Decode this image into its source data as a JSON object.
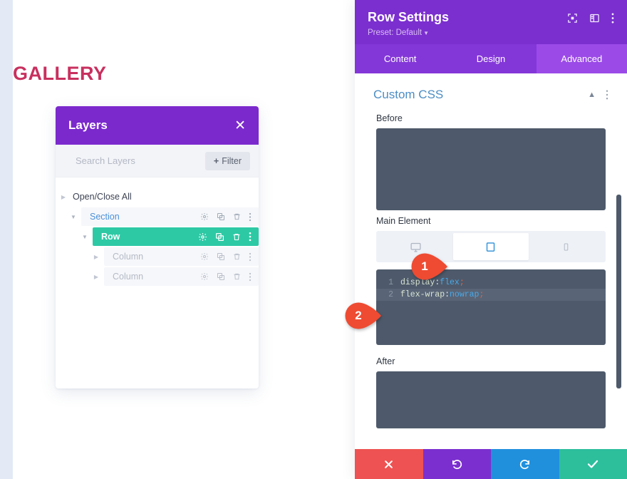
{
  "canvas": {
    "heading": "GALLERY",
    "heading_color": "#c8305f"
  },
  "layers_panel": {
    "title": "Layers",
    "close_icon": "close-icon",
    "search_placeholder": "Search Layers",
    "search_value": "",
    "filter_label": "Filter",
    "filter_plus": "+",
    "open_close_all": "Open/Close All",
    "row_icons": [
      "gear-icon",
      "duplicate-icon",
      "trash-icon",
      "more-vertical-icon"
    ],
    "tree": [
      {
        "label": "Section",
        "state": "plain",
        "indent": 1,
        "expanded": true
      },
      {
        "label": "Row",
        "state": "active",
        "indent": 2,
        "expanded": true
      },
      {
        "label": "Column",
        "state": "dim",
        "indent": 3,
        "expanded": false
      },
      {
        "label": "Column",
        "state": "dim",
        "indent": 3,
        "expanded": false
      }
    ]
  },
  "settings": {
    "title": "Row Settings",
    "preset_label": "Preset: Default",
    "header_icons": [
      "focus-icon",
      "layout-panel-icon",
      "more-vertical-icon"
    ],
    "tabs": [
      {
        "label": "Content",
        "active": false
      },
      {
        "label": "Design",
        "active": false
      },
      {
        "label": "Advanced",
        "active": true
      }
    ],
    "section": {
      "title": "Custom CSS",
      "collapse_icon": "chevron-up-icon",
      "menu_icon": "more-vertical-icon"
    },
    "fields": {
      "before_label": "Before",
      "main_element_label": "Main Element",
      "after_label": "After"
    },
    "device_toggle": {
      "options": [
        {
          "name": "desktop",
          "active": false
        },
        {
          "name": "tablet",
          "active": true
        },
        {
          "name": "phone",
          "active": false
        }
      ]
    },
    "code_editor": {
      "lines": [
        {
          "num": "1",
          "prop": "display",
          "colon": ":",
          "value": "flex",
          "semi": ";",
          "highlight": false
        },
        {
          "num": "2",
          "prop": "flex-wrap",
          "colon": ":",
          "value": "nowrap",
          "semi": ";",
          "highlight": true
        }
      ]
    },
    "bottom_bar": [
      {
        "name": "cancel-button",
        "icon": "close-icon",
        "color": "#ee5252"
      },
      {
        "name": "undo-button",
        "icon": "undo-icon",
        "color": "#7b2fcf"
      },
      {
        "name": "redo-button",
        "icon": "redo-icon",
        "color": "#2090dd"
      },
      {
        "name": "save-button",
        "icon": "checkmark-icon",
        "color": "#2dbe9c"
      }
    ]
  },
  "callouts": [
    {
      "number": "1",
      "color": "#ee4b32"
    },
    {
      "number": "2",
      "color": "#ee4b32"
    }
  ]
}
